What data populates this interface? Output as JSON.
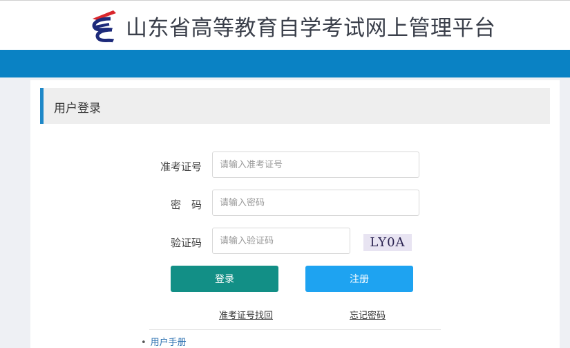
{
  "header": {
    "site_title": "山东省高等教育自学考试网上管理平台",
    "logo_icon": "exam-board-logo-icon"
  },
  "colors": {
    "brand_blue": "#0a82c4",
    "login_button": "#128f86",
    "register_button": "#1ea3f1",
    "header_accent": "#1e88c8"
  },
  "login_section": {
    "title": "用户登录",
    "fields": {
      "exam_id": {
        "label": "准考证号",
        "placeholder": "请输入准考证号",
        "value": ""
      },
      "password": {
        "label": "密　码",
        "placeholder": "请输入密码",
        "value": ""
      },
      "captcha": {
        "label": "验证码",
        "placeholder": "请输入验证码",
        "value": "",
        "image_text": "LY0A"
      }
    },
    "buttons": {
      "login": "登录",
      "register": "注册"
    },
    "links": {
      "recover_exam_id": "准考证号找回",
      "forgot_password": "忘记密码"
    }
  },
  "manual": {
    "items": [
      "用户手册"
    ]
  }
}
